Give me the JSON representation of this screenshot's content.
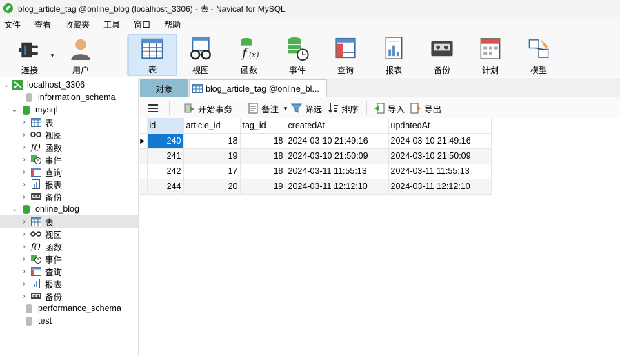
{
  "window": {
    "title": "blog_article_tag @online_blog (localhost_3306) - 表 - Navicat for MySQL"
  },
  "menu": [
    "文件",
    "查看",
    "收藏夹",
    "工具",
    "窗口",
    "帮助"
  ],
  "toolbar": {
    "connect": "连接",
    "user": "用户",
    "table": "表",
    "view": "视图",
    "function": "函数",
    "event": "事件",
    "query": "查询",
    "report": "报表",
    "backup": "备份",
    "schedule": "计划",
    "model": "模型"
  },
  "tree": {
    "connection": "localhost_3306",
    "information_schema": "information_schema",
    "mysql": "mysql",
    "mysql_children": [
      "表",
      "视图",
      "函数",
      "事件",
      "查询",
      "报表",
      "备份"
    ],
    "online_blog": "online_blog",
    "online_blog_children": [
      "表",
      "视图",
      "函数",
      "事件",
      "查询",
      "报表",
      "备份"
    ],
    "performance_schema": "performance_schema",
    "test": "test"
  },
  "tabs": {
    "objects": "对象",
    "table_tab": "blog_article_tag @online_bl..."
  },
  "subtoolbar": {
    "begin_transaction": "开始事务",
    "note": "备注",
    "filter": "筛选",
    "sort": "排序",
    "import": "导入",
    "export": "导出"
  },
  "grid": {
    "columns": [
      "id",
      "article_id",
      "tag_id",
      "createdAt",
      "updatedAt"
    ],
    "rows": [
      [
        "240",
        "18",
        "18",
        "2024-03-10 21:49:16",
        "2024-03-10 21:49:16"
      ],
      [
        "241",
        "19",
        "18",
        "2024-03-10 21:50:09",
        "2024-03-10 21:50:09"
      ],
      [
        "242",
        "17",
        "18",
        "2024-03-11 11:55:13",
        "2024-03-11 11:55:13"
      ],
      [
        "244",
        "20",
        "19",
        "2024-03-11 12:12:10",
        "2024-03-11 12:12:10"
      ]
    ]
  },
  "colors": {
    "selected_cell": "#1279d2",
    "objects_tab": "#8dbcd0",
    "db_green": "#3aa53a"
  }
}
